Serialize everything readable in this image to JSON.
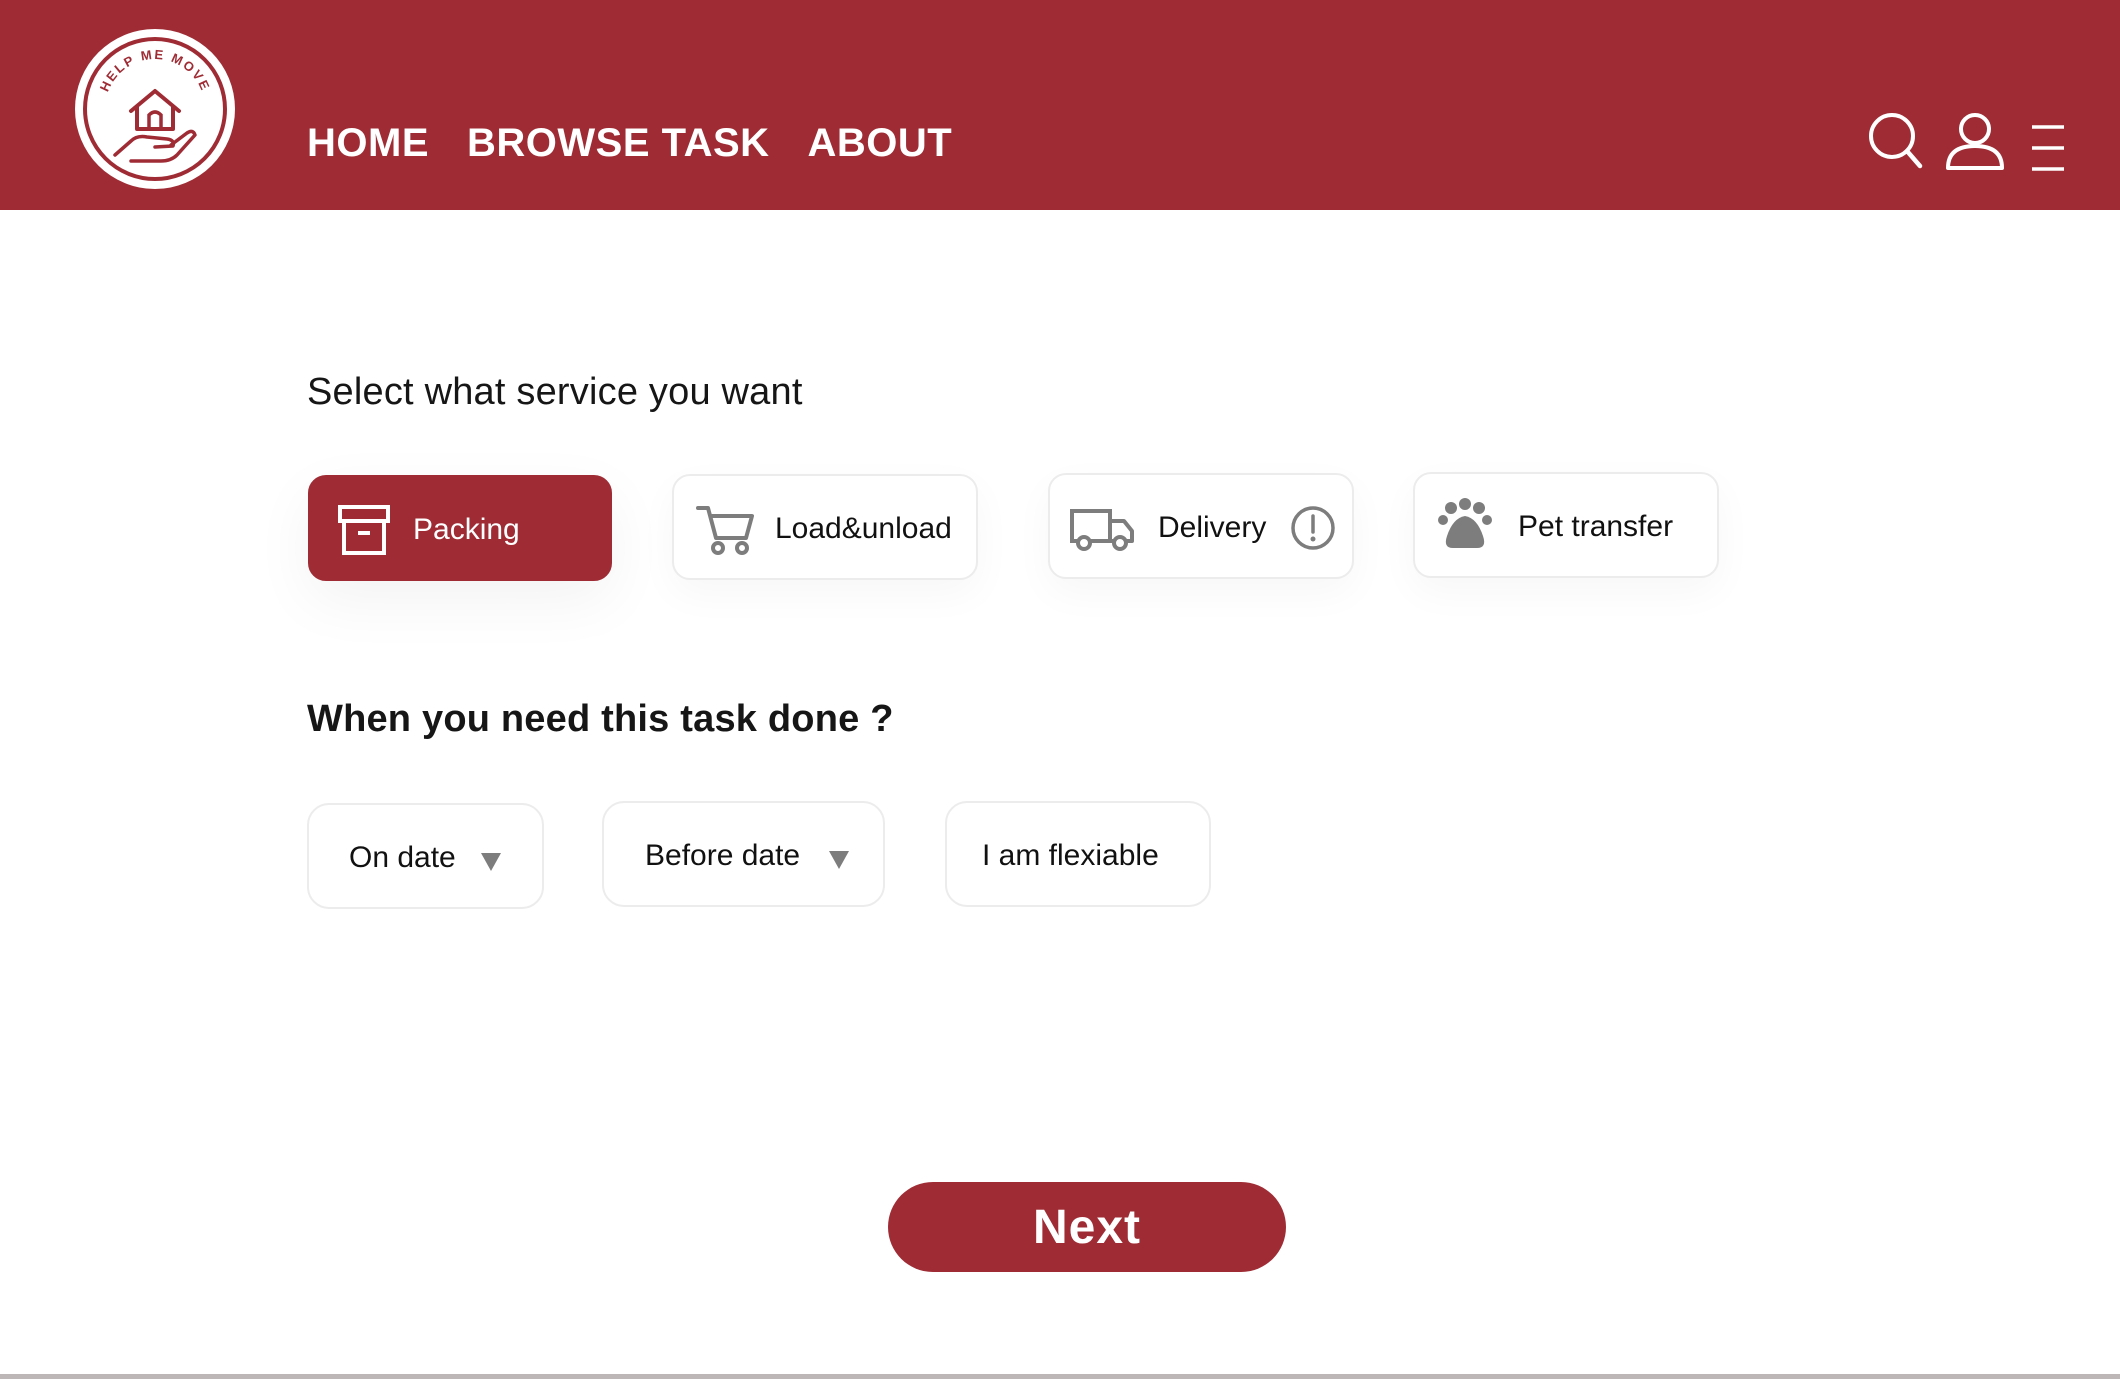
{
  "colors": {
    "brand": "#9f2c35",
    "text": "#111111",
    "icon_gray": "#7d7d7d",
    "white": "#ffffff"
  },
  "logo": {
    "text": "HELP ME MOVE"
  },
  "nav": {
    "items": [
      "HOME",
      "BROWSE TASK",
      "ABOUT"
    ]
  },
  "header_icons": [
    "search-icon",
    "user-icon",
    "menu-icon"
  ],
  "service": {
    "title": "Select what service you want",
    "options": [
      {
        "label": "Packing",
        "icon": "box-icon",
        "selected": true
      },
      {
        "label": "Load&unload",
        "icon": "cart-icon",
        "selected": false
      },
      {
        "label": "Delivery",
        "icon": "truck-icon",
        "info_icon": "info-icon",
        "selected": false
      },
      {
        "label": "Pet transfer",
        "icon": "paw-icon",
        "selected": false
      }
    ]
  },
  "timing": {
    "title": "When you need this task done ?",
    "options": [
      {
        "label": "On date",
        "dropdown": true
      },
      {
        "label": "Before date",
        "dropdown": true
      },
      {
        "label": "I am flexiable",
        "dropdown": false
      }
    ]
  },
  "next_label": "Next"
}
